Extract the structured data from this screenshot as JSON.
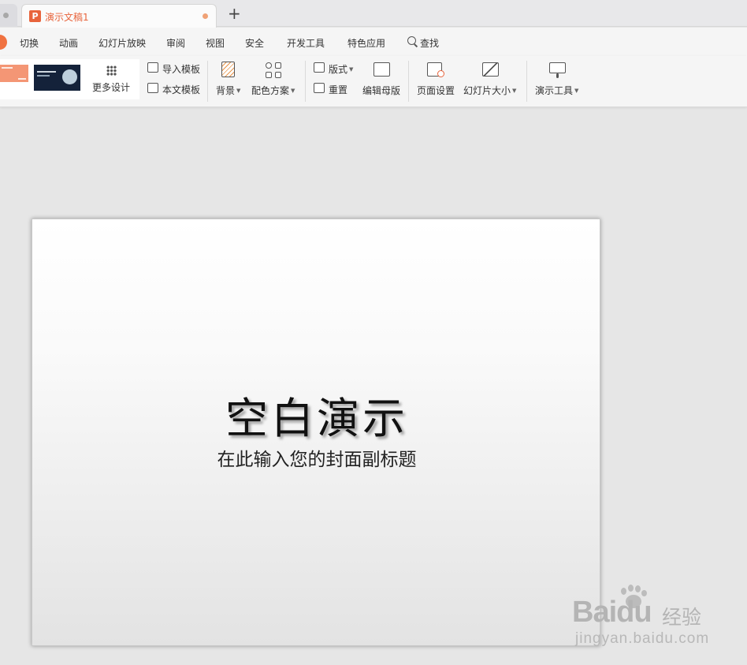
{
  "tabs": {
    "document_title": "演示文稿1",
    "new_tab_glyph": "+"
  },
  "menu": {
    "items": [
      "切换",
      "动画",
      "幻灯片放映",
      "审阅",
      "视图",
      "安全",
      "开发工具",
      "特色应用"
    ],
    "search_label": "查找"
  },
  "ribbon": {
    "more_design": "更多设计",
    "import_template": "导入模板",
    "this_template": "本文模板",
    "background": "背景",
    "color_scheme": "配色方案",
    "layout": "版式",
    "reset": "重置",
    "edit_master": "编辑母版",
    "page_setup": "页面设置",
    "slide_size": "幻灯片大小",
    "presentation_tools": "演示工具"
  },
  "slide": {
    "title": "空白演示",
    "subtitle": "在此输入您的封面副标题"
  },
  "watermark": {
    "brand": "Baidu",
    "product": "经验",
    "url": "jingyan.baidu.com"
  },
  "colors": {
    "accent": "#e8643c",
    "workspace": "#e6e6e6",
    "ribbon": "#f5f5f5"
  }
}
